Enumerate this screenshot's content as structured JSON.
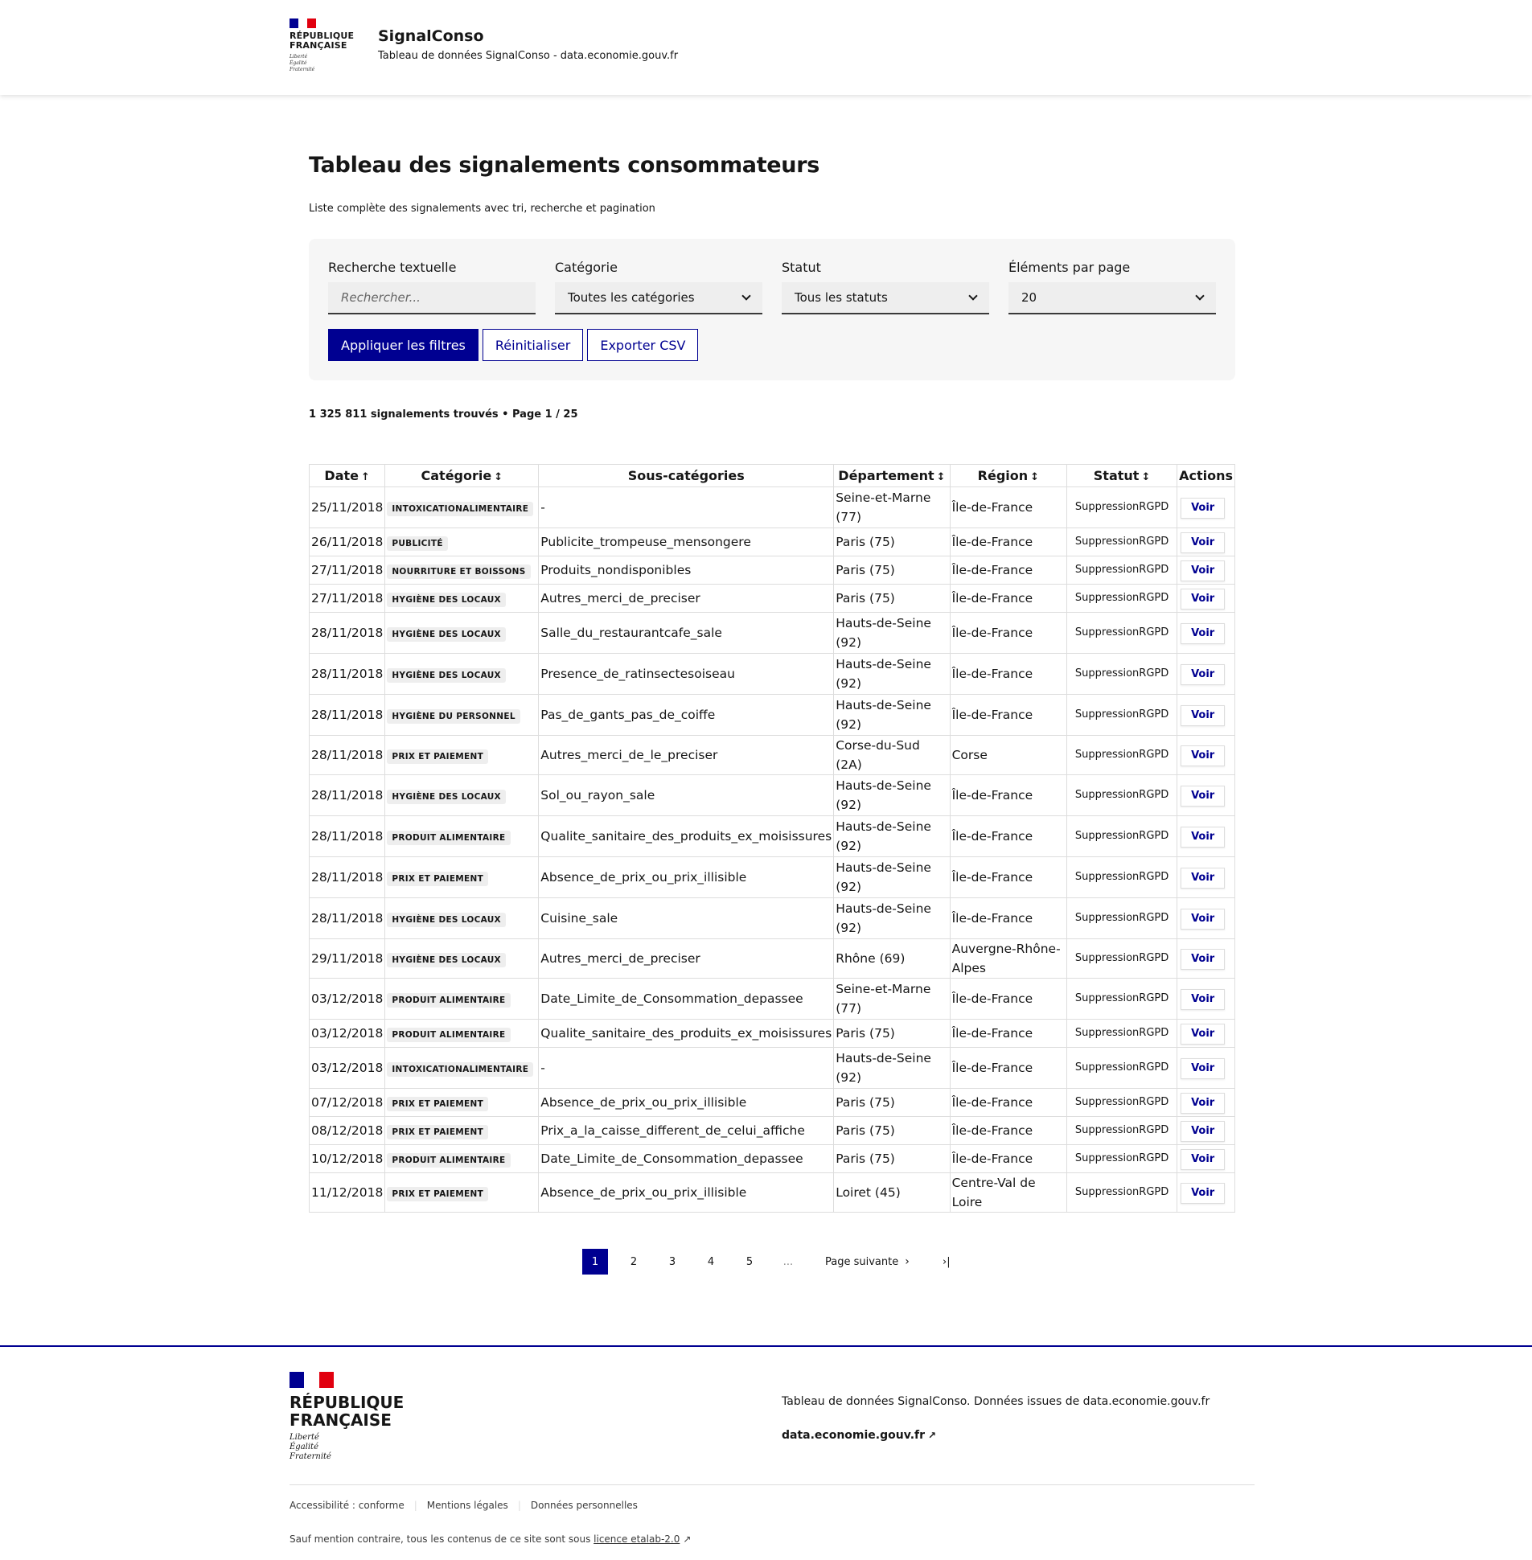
{
  "header": {
    "rf_line1": "RÉPUBLIQUE",
    "rf_line2": "FRANÇAISE",
    "devise": [
      "Liberté",
      "Égalité",
      "Fraternité"
    ],
    "service_title": "SignalConso",
    "service_tagline": "Tableau de données SignalConso - data.economie.gouv.fr"
  },
  "main": {
    "title": "Tableau des signalements consommateurs",
    "subtitle": "Liste complète des signalements avec tri, recherche et pagination"
  },
  "filters": {
    "search_label": "Recherche textuelle",
    "search_placeholder": "Rechercher...",
    "category_label": "Catégorie",
    "category_value": "Toutes les catégories",
    "status_label": "Statut",
    "status_value": "Tous les statuts",
    "per_page_label": "Éléments par page",
    "per_page_value": "20",
    "apply_label": "Appliquer les filtres",
    "reset_label": "Réinitialiser",
    "export_label": "Exporter CSV"
  },
  "results": {
    "count_text": "1 325 811 signalements trouvés • Page 1 / 25"
  },
  "table": {
    "headers": {
      "date": "Date",
      "categorie": "Catégorie",
      "sous_categories": "Sous-catégories",
      "departement": "Département",
      "region": "Région",
      "statut": "Statut",
      "actions": "Actions"
    },
    "sort_icons": {
      "date": "↑",
      "other": "↕"
    },
    "action_label": "Voir",
    "rows": [
      {
        "date": "25/11/2018",
        "categorie": "IntoxicationAlimentaire",
        "sous": "-",
        "dep": "Seine-et-Marne (77)",
        "region": "Île-de-France",
        "statut": "SuppressionRGPD"
      },
      {
        "date": "26/11/2018",
        "categorie": "Publicité",
        "sous": "Publicite_trompeuse_mensongere",
        "dep": "Paris (75)",
        "region": "Île-de-France",
        "statut": "SuppressionRGPD"
      },
      {
        "date": "27/11/2018",
        "categorie": "Nourriture et boissons",
        "sous": "Produits_nondisponibles",
        "dep": "Paris (75)",
        "region": "Île-de-France",
        "statut": "SuppressionRGPD"
      },
      {
        "date": "27/11/2018",
        "categorie": "Hygiène des locaux",
        "sous": "Autres_merci_de_preciser",
        "dep": "Paris (75)",
        "region": "Île-de-France",
        "statut": "SuppressionRGPD"
      },
      {
        "date": "28/11/2018",
        "categorie": "Hygiène des locaux",
        "sous": "Salle_du_restaurantcafe_sale",
        "dep": "Hauts-de-Seine (92)",
        "region": "Île-de-France",
        "statut": "SuppressionRGPD"
      },
      {
        "date": "28/11/2018",
        "categorie": "Hygiène des locaux",
        "sous": "Presence_de_ratinsectesoiseau",
        "dep": "Hauts-de-Seine (92)",
        "region": "Île-de-France",
        "statut": "SuppressionRGPD"
      },
      {
        "date": "28/11/2018",
        "categorie": "Hygiène du personnel",
        "sous": "Pas_de_gants_pas_de_coiffe",
        "dep": "Hauts-de-Seine (92)",
        "region": "Île-de-France",
        "statut": "SuppressionRGPD"
      },
      {
        "date": "28/11/2018",
        "categorie": "Prix et paiement",
        "sous": "Autres_merci_de_le_preciser",
        "dep": "Corse-du-Sud (2A)",
        "region": "Corse",
        "statut": "SuppressionRGPD"
      },
      {
        "date": "28/11/2018",
        "categorie": "Hygiène des locaux",
        "sous": "Sol_ou_rayon_sale",
        "dep": "Hauts-de-Seine (92)",
        "region": "Île-de-France",
        "statut": "SuppressionRGPD"
      },
      {
        "date": "28/11/2018",
        "categorie": "Produit alimentaire",
        "sous": "Qualite_sanitaire_des_produits_ex_moisissures",
        "dep": "Hauts-de-Seine (92)",
        "region": "Île-de-France",
        "statut": "SuppressionRGPD"
      },
      {
        "date": "28/11/2018",
        "categorie": "Prix et paiement",
        "sous": "Absence_de_prix_ou_prix_illisible",
        "dep": "Hauts-de-Seine (92)",
        "region": "Île-de-France",
        "statut": "SuppressionRGPD"
      },
      {
        "date": "28/11/2018",
        "categorie": "Hygiène des locaux",
        "sous": "Cuisine_sale",
        "dep": "Hauts-de-Seine (92)",
        "region": "Île-de-France",
        "statut": "SuppressionRGPD"
      },
      {
        "date": "29/11/2018",
        "categorie": "Hygiène des locaux",
        "sous": "Autres_merci_de_preciser",
        "dep": "Rhône (69)",
        "region": "Auvergne-Rhône-Alpes",
        "statut": "SuppressionRGPD"
      },
      {
        "date": "03/12/2018",
        "categorie": "Produit alimentaire",
        "sous": "Date_Limite_de_Consommation_depassee",
        "dep": "Seine-et-Marne (77)",
        "region": "Île-de-France",
        "statut": "SuppressionRGPD"
      },
      {
        "date": "03/12/2018",
        "categorie": "Produit alimentaire",
        "sous": "Qualite_sanitaire_des_produits_ex_moisissures",
        "dep": "Paris (75)",
        "region": "Île-de-France",
        "statut": "SuppressionRGPD"
      },
      {
        "date": "03/12/2018",
        "categorie": "IntoxicationAlimentaire",
        "sous": "-",
        "dep": "Hauts-de-Seine (92)",
        "region": "Île-de-France",
        "statut": "SuppressionRGPD"
      },
      {
        "date": "07/12/2018",
        "categorie": "Prix et paiement",
        "sous": "Absence_de_prix_ou_prix_illisible",
        "dep": "Paris (75)",
        "region": "Île-de-France",
        "statut": "SuppressionRGPD"
      },
      {
        "date": "08/12/2018",
        "categorie": "Prix et paiement",
        "sous": "Prix_a_la_caisse_different_de_celui_affiche",
        "dep": "Paris (75)",
        "region": "Île-de-France",
        "statut": "SuppressionRGPD"
      },
      {
        "date": "10/12/2018",
        "categorie": "Produit alimentaire",
        "sous": "Date_Limite_de_Consommation_depassee",
        "dep": "Paris (75)",
        "region": "Île-de-France",
        "statut": "SuppressionRGPD"
      },
      {
        "date": "11/12/2018",
        "categorie": "Prix et paiement",
        "sous": "Absence_de_prix_ou_prix_illisible",
        "dep": "Loiret (45)",
        "region": "Centre-Val de Loire",
        "statut": "SuppressionRGPD"
      }
    ]
  },
  "pagination": {
    "pages": [
      "1",
      "2",
      "3",
      "4",
      "5"
    ],
    "current": "1",
    "ellipsis": "...",
    "next_label": "Page suivante",
    "next_icon": "›",
    "last_icon": "›|"
  },
  "footer": {
    "rf_line1": "RÉPUBLIQUE",
    "rf_line2": "FRANÇAISE",
    "devise": [
      "Liberté",
      "Égalité",
      "Fraternité"
    ],
    "description": "Tableau de données SignalConso. Données issues de data.economie.gouv.fr",
    "link_label": "data.economie.gouv.fr",
    "bottom_links": [
      "Accessibilité : conforme",
      "Mentions légales",
      "Données personnelles"
    ],
    "licence_prefix": "Sauf mention contraire, tous les contenus de ce site sont sous",
    "licence_link": "licence etalab-2.0"
  },
  "colors": {
    "primary": "#000091",
    "marianne_red": "#e1000f",
    "badge_bg": "#eeeeee"
  }
}
